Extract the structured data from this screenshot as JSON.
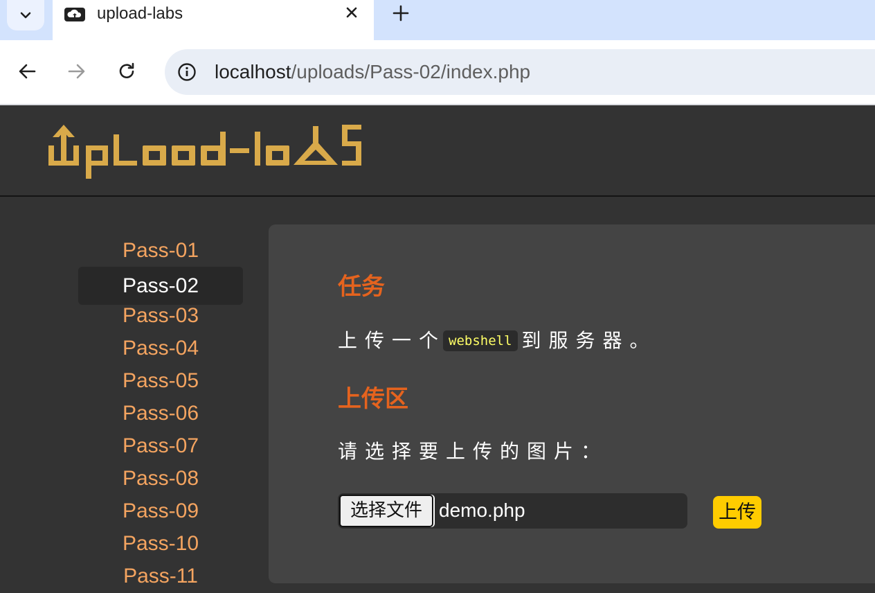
{
  "browser": {
    "tab_title": "upload-labs",
    "url_host": "localhost",
    "url_path": "/uploads/Pass-02/index.php"
  },
  "header": {
    "logo_text": "Upload-labs"
  },
  "sidebar": {
    "items": [
      {
        "label": "Pass-01"
      },
      {
        "label": "Pass-02"
      },
      {
        "label": "Pass-03"
      },
      {
        "label": "Pass-04"
      },
      {
        "label": "Pass-05"
      },
      {
        "label": "Pass-06"
      },
      {
        "label": "Pass-07"
      },
      {
        "label": "Pass-08"
      },
      {
        "label": "Pass-09"
      },
      {
        "label": "Pass-10"
      },
      {
        "label": "Pass-11"
      }
    ],
    "active_index": 1
  },
  "main": {
    "task_heading": "任务",
    "task_text_before": "上传一个",
    "task_code": "webshell",
    "task_text_after": "到服务器。",
    "upload_heading": "上传区",
    "upload_prompt": "请选择要上传的图片：",
    "file_button_label": "选择文件",
    "file_name": "demo.php",
    "upload_button_label": "上传"
  },
  "colors": {
    "accent_orange": "#e5631e",
    "link_orange": "#f4a460",
    "logo_gold": "#d9aa4a",
    "upload_yellow": "#ffcc00",
    "code_yellow": "#ffff66"
  }
}
